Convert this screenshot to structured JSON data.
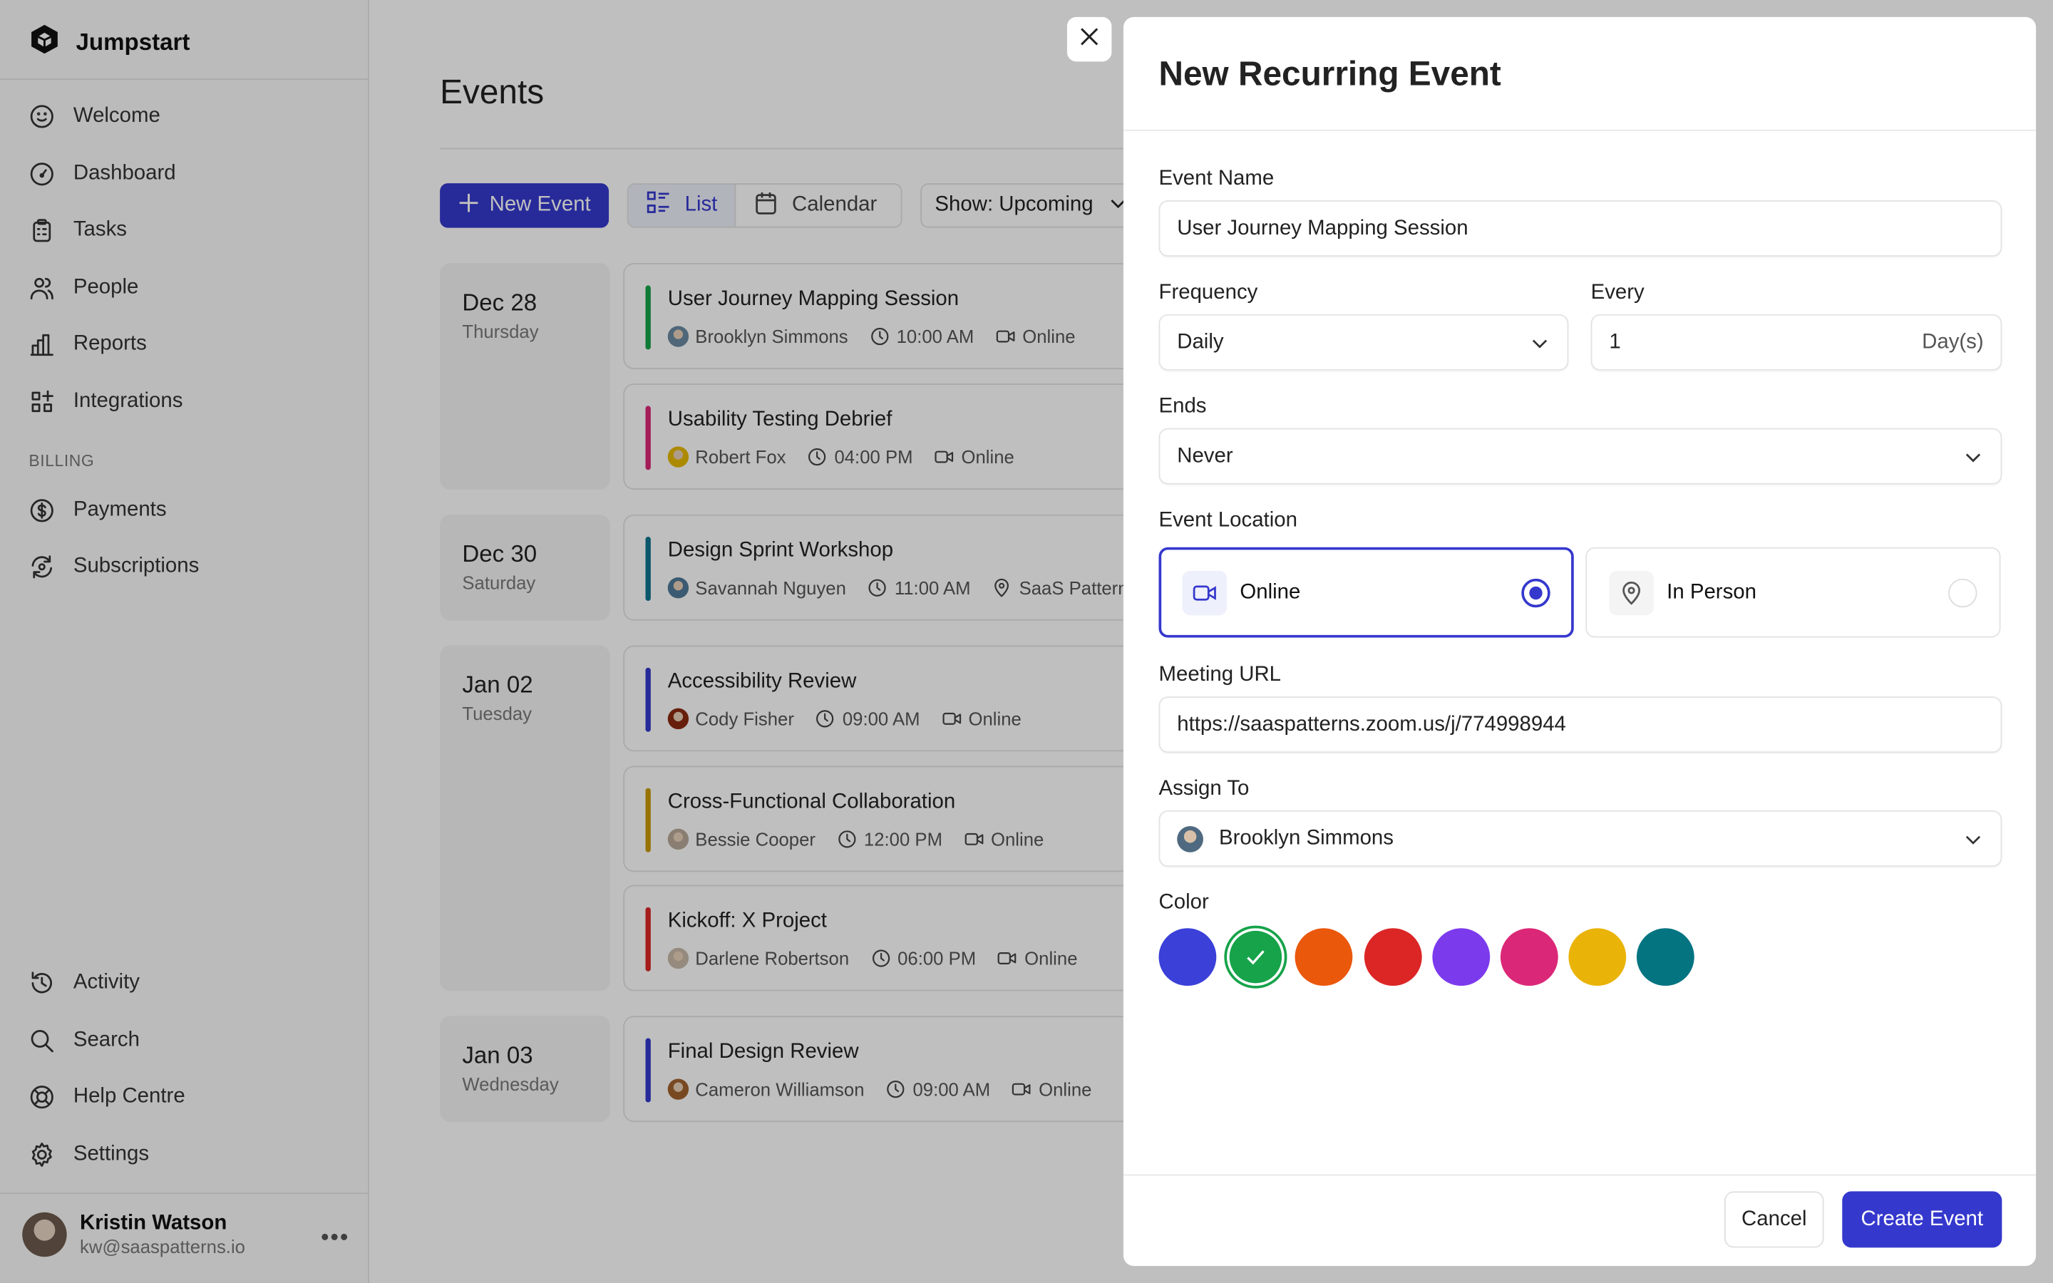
{
  "app": {
    "name": "Jumpstart",
    "logo_icon": "cube-logo-icon"
  },
  "sidebar": {
    "items": [
      {
        "label": "Welcome",
        "icon": "smile-icon"
      },
      {
        "label": "Dashboard",
        "icon": "gauge-icon"
      },
      {
        "label": "Tasks",
        "icon": "clipboard-icon"
      },
      {
        "label": "People",
        "icon": "people-icon"
      },
      {
        "label": "Reports",
        "icon": "bar-chart-icon"
      },
      {
        "label": "Integrations",
        "icon": "grid-plus-icon"
      }
    ],
    "billing_heading": "BILLING",
    "billing_items": [
      {
        "label": "Payments",
        "icon": "dollar-circle-icon"
      },
      {
        "label": "Subscriptions",
        "icon": "refresh-icon"
      }
    ],
    "bottom_items": [
      {
        "label": "Activity",
        "icon": "history-icon"
      },
      {
        "label": "Search",
        "icon": "search-icon"
      },
      {
        "label": "Help Centre",
        "icon": "lifebuoy-icon"
      },
      {
        "label": "Settings",
        "icon": "gear-icon"
      }
    ],
    "user": {
      "name": "Kristin Watson",
      "email": "kw@saaspatterns.io",
      "more": "•••"
    }
  },
  "main": {
    "title": "Events",
    "new_event_label": "New Event",
    "view_list": "List",
    "view_calendar": "Calendar",
    "show_filter": "Show: Upcoming",
    "groups": [
      {
        "date": "Dec 28",
        "weekday": "Thursday",
        "events": [
          {
            "title": "User Journey Mapping Session",
            "person": "Brooklyn Simmons",
            "time": "10:00 AM",
            "location": "Online",
            "location_icon": "video-icon",
            "color": "#16a34a",
            "avatar": "#6b8aa3"
          },
          {
            "title": "Usability Testing Debrief",
            "person": "Robert Fox",
            "time": "04:00 PM",
            "location": "Online",
            "location_icon": "video-icon",
            "color": "#db2777",
            "avatar": "#e6b800"
          }
        ]
      },
      {
        "date": "Dec 30",
        "weekday": "Saturday",
        "events": [
          {
            "title": "Design Sprint Workshop",
            "person": "Savannah Nguyen",
            "time": "11:00 AM",
            "location": "SaaS Pattern I",
            "location_icon": "map-pin-icon",
            "color": "#0e7490",
            "avatar": "#4f7a99"
          }
        ]
      },
      {
        "date": "Jan 02",
        "weekday": "Tuesday",
        "events": [
          {
            "title": "Accessibility Review",
            "person": "Cody Fisher",
            "time": "09:00 AM",
            "location": "Online",
            "location_icon": "video-icon",
            "color": "#3538cd",
            "avatar": "#8a2a10"
          },
          {
            "title": "Cross-Functional Collaboration",
            "person": "Bessie Cooper",
            "time": "12:00 PM",
            "location": "Online",
            "location_icon": "video-icon",
            "color": "#ca9a04",
            "avatar": "#b8a898"
          },
          {
            "title": "Kickoff: X Project",
            "person": "Darlene Robertson",
            "time": "06:00 PM",
            "location": "Online",
            "location_icon": "video-icon",
            "color": "#dc2626",
            "avatar": "#c9b8a8"
          }
        ]
      },
      {
        "date": "Jan 03",
        "weekday": "Wednesday",
        "events": [
          {
            "title": "Final Design Review",
            "person": "Cameron Williamson",
            "time": "09:00 AM",
            "location": "Online",
            "location_icon": "video-icon",
            "color": "#3538cd",
            "avatar": "#a0622d"
          }
        ]
      }
    ]
  },
  "modal": {
    "title": "New Recurring Event",
    "event_name_label": "Event Name",
    "event_name_value": "User Journey Mapping Session",
    "frequency_label": "Frequency",
    "frequency_value": "Daily",
    "every_label": "Every",
    "every_value": "1",
    "every_unit": "Day(s)",
    "ends_label": "Ends",
    "ends_value": "Never",
    "location_label": "Event Location",
    "location_options": [
      {
        "label": "Online",
        "icon": "video-icon",
        "selected": true
      },
      {
        "label": "In Person",
        "icon": "map-pin-icon",
        "selected": false
      }
    ],
    "meeting_url_label": "Meeting URL",
    "meeting_url_value": "https://saaspatterns.zoom.us/j/774998944",
    "assign_label": "Assign To",
    "assign_value": "Brooklyn Simmons",
    "color_label": "Color",
    "colors": [
      "#3b40d8",
      "#16a34a",
      "#ea580c",
      "#dc2626",
      "#7c3aed",
      "#db2777",
      "#eab308",
      "#047481"
    ],
    "selected_color": "#16a34a",
    "cancel_label": "Cancel",
    "create_label": "Create Event",
    "accent": "#3538cd"
  }
}
